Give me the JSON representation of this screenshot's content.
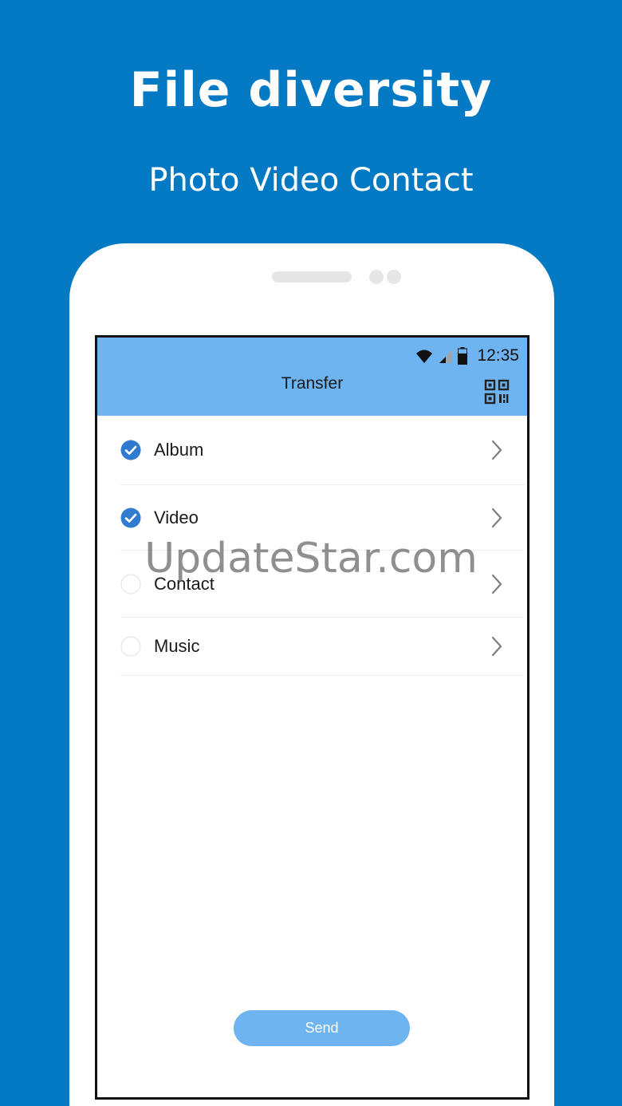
{
  "promo": {
    "headline": "File diversity",
    "subheadline": "Photo Video Contact"
  },
  "status_bar": {
    "time": "12:35",
    "icons": [
      "wifi-icon",
      "signal-icon",
      "battery-icon"
    ]
  },
  "app_bar": {
    "title": "Transfer",
    "action_icon": "qr-code-icon"
  },
  "file_types": [
    {
      "label": "Album",
      "checked": true
    },
    {
      "label": "Video",
      "checked": true
    },
    {
      "label": "Contact",
      "checked": false
    },
    {
      "label": "Music",
      "checked": false
    }
  ],
  "send_label": "Send",
  "watermark": "UpdateStar.com",
  "colors": {
    "background": "#0479c4",
    "app_bar": "#6eb4f0",
    "check": "#2f7bd0",
    "send_button": "#6eb4f0"
  }
}
